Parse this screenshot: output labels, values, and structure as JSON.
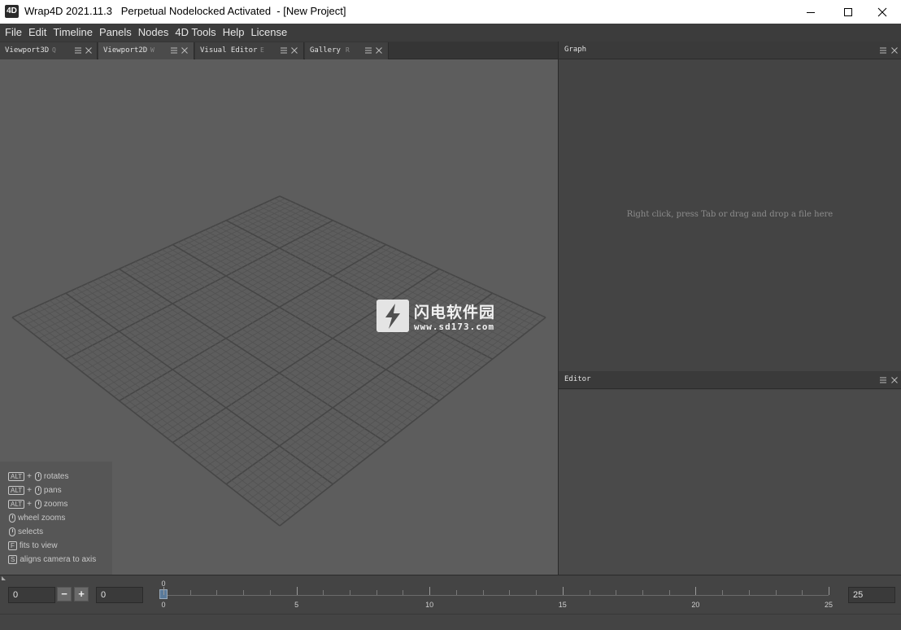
{
  "window": {
    "app_icon_text": "4D",
    "title": "Wrap4D 2021.11.3   Perpetual Nodelocked Activated  - [New Project]"
  },
  "menu": [
    "File",
    "Edit",
    "Timeline",
    "Panels",
    "Nodes",
    "4D Tools",
    "Help",
    "License"
  ],
  "tabs": [
    {
      "label": "Viewport3D",
      "key": "Q"
    },
    {
      "label": "Viewport2D",
      "key": "W"
    },
    {
      "label": "Visual Editor",
      "key": "E"
    },
    {
      "label": "Gallery",
      "key": "R"
    }
  ],
  "viewport": {
    "hints": [
      {
        "key": "ALT",
        "plus": "+",
        "text": "rotates"
      },
      {
        "key": "ALT",
        "plus": "+",
        "text": "pans"
      },
      {
        "key": "ALT",
        "plus": "+",
        "text": "zooms"
      },
      {
        "key": "",
        "plus": "",
        "text": "wheel zooms"
      },
      {
        "key": "",
        "plus": "",
        "text": "selects"
      },
      {
        "key": "F",
        "plus": "",
        "text": "fits to view"
      },
      {
        "key": "S",
        "plus": "",
        "text": "aligns camera to axis"
      }
    ],
    "watermark": {
      "cn": "闪电软件园",
      "url": "www.sd173.com"
    }
  },
  "graph": {
    "title": "Graph",
    "hint": "Right click, press Tab or drag and drop a file here"
  },
  "editor": {
    "title": "Editor"
  },
  "timeline": {
    "start_value": "0",
    "minus_label": "−",
    "plus_label": "+",
    "current_value": "0",
    "end_value": "25",
    "playhead_label": "0",
    "tick_labels": [
      "0",
      "5",
      "10",
      "15",
      "20",
      "25"
    ],
    "frame_min": 0,
    "frame_max": 25,
    "current_frame": 0
  }
}
